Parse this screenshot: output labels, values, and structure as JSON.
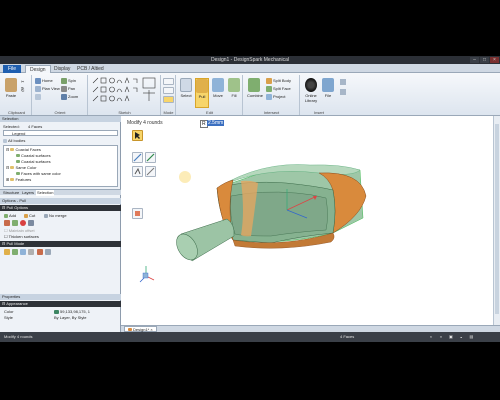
{
  "window": {
    "title": "Design1 - DesignSpark Mechanical"
  },
  "tabs": {
    "file": "File",
    "design": "Design",
    "display": "Display",
    "pcb": "PCB / Altied"
  },
  "ribbon": {
    "clipboard": {
      "label": "Clipboard",
      "paste": "Paste"
    },
    "orient": {
      "label": "Orient",
      "home": "Home",
      "plan": "Plan View",
      "spin": "Spin",
      "pan": "Pan",
      "zoom": "Zoom"
    },
    "sketch": {
      "label": "Sketch"
    },
    "mode": {
      "label": "Mode"
    },
    "edit": {
      "label": "Edit",
      "select": "Select",
      "pull": "Pull",
      "move": "Move",
      "fill": "Fill"
    },
    "intersect": {
      "label": "Intersect",
      "combine": "Combine",
      "split_body": "Split Body",
      "split_face": "Split Face",
      "project": "Project"
    },
    "insert": {
      "label": "Insert",
      "online_library": "Online Library",
      "file": "File"
    }
  },
  "selection_panel": {
    "header": "Selection",
    "selected_label": "Selected:",
    "selected_value": "4 Faces",
    "legend": "Legend",
    "all_bodies": "All bodies",
    "items": [
      {
        "label": "Coaxial Faces"
      },
      {
        "label": "Coaxial surfaces"
      },
      {
        "label": "Coaxial surfaces"
      },
      {
        "label": "Same Color"
      },
      {
        "label": "Faces with same color"
      },
      {
        "label": "Features"
      }
    ],
    "tabs": [
      "Structure",
      "Layers",
      "Selection"
    ]
  },
  "options_panel": {
    "header": "Options - Pull",
    "pull_options": "Pull Options",
    "add": "Add",
    "cut": "Cut",
    "no_merge": "No merge",
    "maintain_offset": "Maintain offset",
    "thicken_surfaces": "Thicken surfaces",
    "pull_mode": "Pull Mode"
  },
  "properties_panel": {
    "header": "Properties",
    "appearance": "Appearance",
    "color_label": "Color",
    "color_value": "59,133,98,175, 1",
    "style_label": "Style",
    "style_value": "By Layer, By Style"
  },
  "viewport": {
    "hint": "Modify 4 rounds",
    "dimension": "R",
    "dimension_value": "2.5mm"
  },
  "doc_tab": {
    "label": "Design1*"
  },
  "status": {
    "left": "Modify 4 rounds",
    "faces": "4 Faces"
  },
  "colors": {
    "model": "#8fb89a",
    "round": "#d98a3c",
    "accent": "#1f5fb0"
  }
}
